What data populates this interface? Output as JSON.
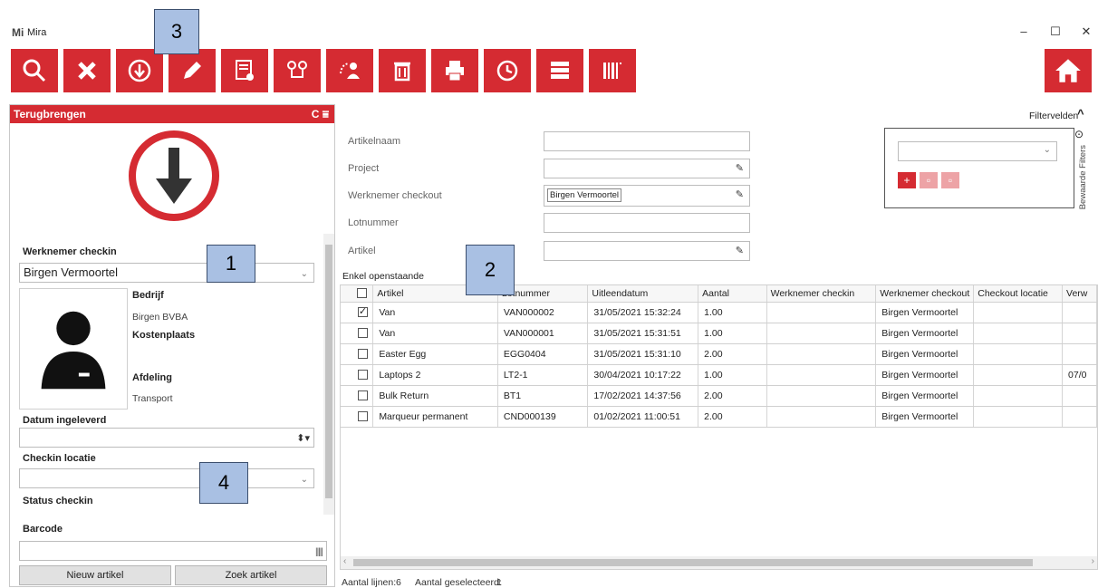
{
  "window": {
    "title": "Mira",
    "logo": "Mi",
    "minimize": "–",
    "maximize": "☐",
    "close": "✕"
  },
  "toolbar": {
    "buttons": [
      "search-icon",
      "close-icon",
      "checkin-arrow-icon",
      "pencil-icon",
      "settings-report-icon",
      "route-icon",
      "user-swap-icon",
      "trash-icon",
      "printer-icon",
      "history-clock-icon",
      "rack-icon",
      "barcode-list-icon"
    ],
    "home": "home-icon"
  },
  "callouts": {
    "c1": "1",
    "c2": "2",
    "c3": "3",
    "c4": "4"
  },
  "left_panel": {
    "title": "Terugbrengen",
    "header_icons": "C ⩸",
    "werknemer_checkin_label": "Werknemer checkin",
    "werknemer_checkin_value": "Birgen Vermoortel",
    "bedrijf_label": "Bedrijf",
    "bedrijf_value": "Birgen BVBA",
    "kostenplaats_label": "Kostenplaats",
    "afdeling_label": "Afdeling",
    "afdeling_value": "Transport",
    "datum_label": "Datum ingeleverd",
    "checkin_locatie_label": "Checkin locatie",
    "status_checkin_label": "Status checkin",
    "barcode_label": "Barcode",
    "nieuw_artikel": "Nieuw artikel",
    "zoek_artikel": "Zoek artikel"
  },
  "filters": {
    "toggle_label": "Filtervelden",
    "artikelnaam": "Artikelnaam",
    "project": "Project",
    "werknemer_checkout": "Werknemer checkout",
    "werknemer_checkout_chip": "Birgen Vermoortel",
    "lotnummer": "Lotnummer",
    "artikel": "Artikel",
    "saved_filters": "Bewaarde Filters"
  },
  "grid": {
    "caption": "Enkel openstaande",
    "columns": [
      "Artikel",
      "Lotnummer",
      "Uitleendatum",
      "Aantal",
      "Werknemer checkin",
      "Werknemer checkout",
      "Checkout locatie",
      "Verw"
    ],
    "rows": [
      {
        "checked": true,
        "cells": [
          "Van",
          "VAN000002",
          "31/05/2021 15:32:24",
          "1.00",
          "",
          "Birgen Vermoortel",
          "",
          ""
        ]
      },
      {
        "checked": false,
        "cells": [
          "Van",
          "VAN000001",
          "31/05/2021 15:31:51",
          "1.00",
          "",
          "Birgen Vermoortel",
          "",
          ""
        ]
      },
      {
        "checked": false,
        "cells": [
          "Easter Egg",
          "EGG0404",
          "31/05/2021 15:31:10",
          "2.00",
          "",
          "Birgen Vermoortel",
          "",
          ""
        ]
      },
      {
        "checked": false,
        "cells": [
          "Laptops 2",
          "LT2-1",
          "30/04/2021 10:17:22",
          "1.00",
          "",
          "Birgen Vermoortel",
          "",
          "07/0"
        ]
      },
      {
        "checked": false,
        "cells": [
          "Bulk Return",
          "BT1",
          "17/02/2021 14:37:56",
          "2.00",
          "",
          "Birgen Vermoortel",
          "",
          ""
        ]
      },
      {
        "checked": false,
        "cells": [
          "Marqueur permanent",
          "CND000139",
          "01/02/2021 11:00:51",
          "2.00",
          "",
          "Birgen Vermoortel",
          "",
          ""
        ]
      }
    ]
  },
  "status": {
    "lines_label": "Aantal lijnen:",
    "lines_value": "6",
    "selected_label": "Aantal geselecteerd:",
    "selected_value": "1"
  },
  "colors": {
    "accent": "#d52b32",
    "callout": "#a9c0e3"
  }
}
